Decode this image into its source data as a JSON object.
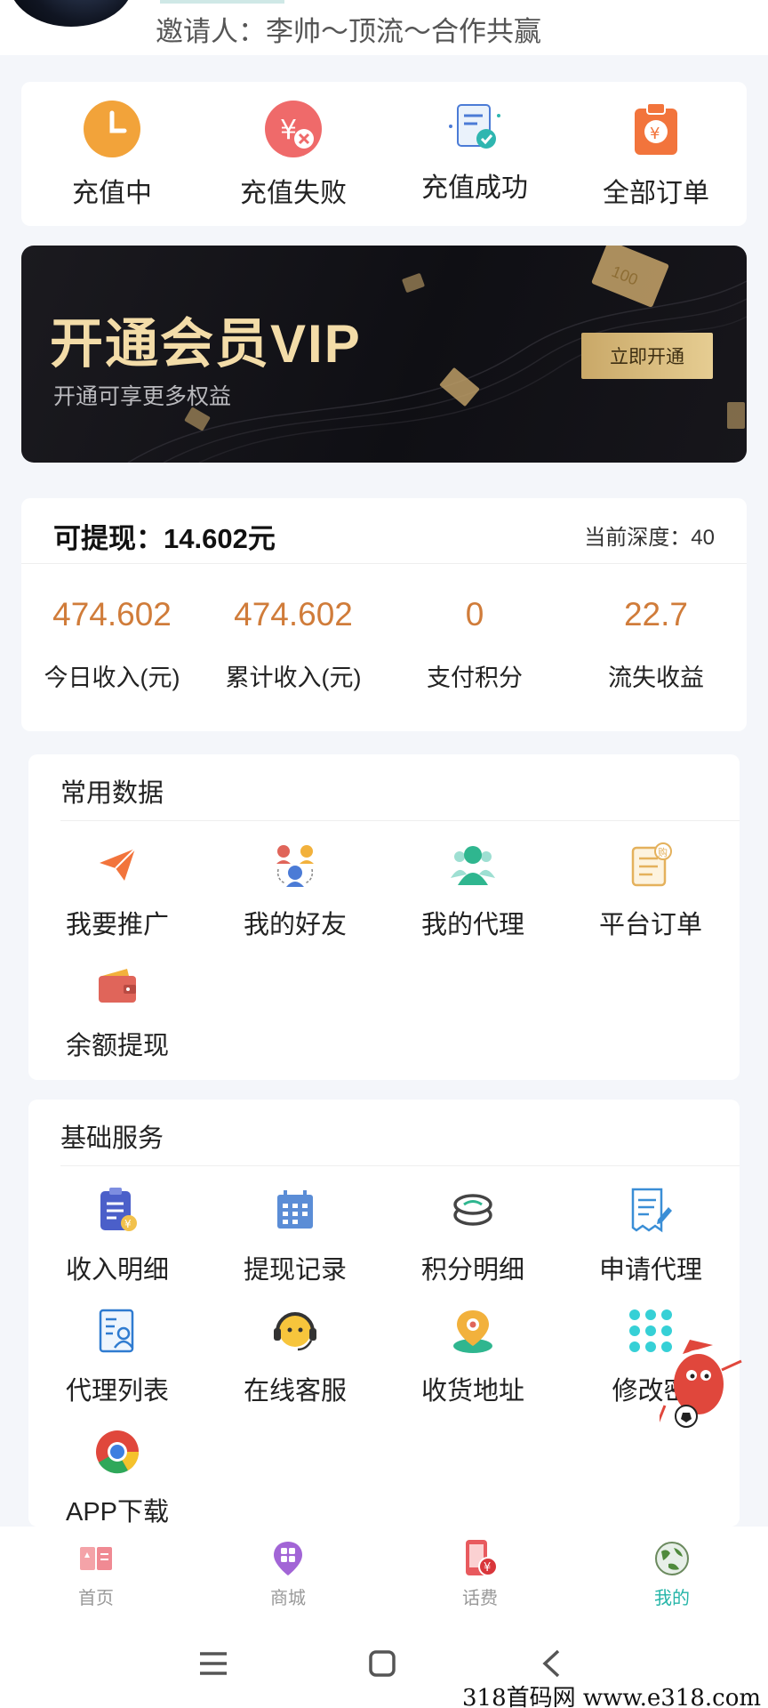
{
  "header": {
    "inviter_text": "邀请人：李帅～顶流～合作共赢"
  },
  "orders": [
    {
      "label": "充值中",
      "icon": "clock-icon"
    },
    {
      "label": "充值失败",
      "icon": "yuan-fail-icon"
    },
    {
      "label": "充值成功",
      "icon": "receipt-success-icon"
    },
    {
      "label": "全部订单",
      "icon": "order-bag-icon"
    }
  ],
  "vip_banner": {
    "title": "开通会员VIP",
    "subtitle": "开通可享更多权益",
    "button": "立即开通",
    "ticket_text": "100"
  },
  "balance": {
    "withdrawable": "可提现：14.602元",
    "depth": "当前深度：40",
    "stats": [
      {
        "value": "474.602",
        "label": "今日收入(元)"
      },
      {
        "value": "474.602",
        "label": "累计收入(元)"
      },
      {
        "value": "0",
        "label": "支付积分"
      },
      {
        "value": "22.7",
        "label": "流失收益"
      }
    ]
  },
  "common_section": {
    "title": "常用数据",
    "items": [
      {
        "label": "我要推广",
        "icon": "paper-plane-icon"
      },
      {
        "label": "我的好友",
        "icon": "friends-icon"
      },
      {
        "label": "我的代理",
        "icon": "agent-icon"
      },
      {
        "label": "平台订单",
        "icon": "platform-order-icon"
      },
      {
        "label": "余额提现",
        "icon": "wallet-icon"
      }
    ]
  },
  "basic_section": {
    "title": "基础服务",
    "items": [
      {
        "label": "收入明细",
        "icon": "income-detail-icon"
      },
      {
        "label": "提现记录",
        "icon": "calendar-icon"
      },
      {
        "label": "积分明细",
        "icon": "coins-icon"
      },
      {
        "label": "申请代理",
        "icon": "apply-form-icon"
      },
      {
        "label": "代理列表",
        "icon": "agent-list-icon"
      },
      {
        "label": "在线客服",
        "icon": "headset-icon"
      },
      {
        "label": "收货地址",
        "icon": "location-pin-icon"
      },
      {
        "label": "修改密",
        "icon": "keypad-icon"
      },
      {
        "label": "APP下载",
        "icon": "chrome-icon"
      }
    ]
  },
  "tabbar": [
    {
      "label": "首页",
      "icon": "home-card-icon",
      "active": false
    },
    {
      "label": "商城",
      "icon": "mall-pin-icon",
      "active": false
    },
    {
      "label": "话费",
      "icon": "phone-bill-icon",
      "active": false
    },
    {
      "label": "我的",
      "icon": "globe-icon",
      "active": true
    }
  ],
  "system_nav": [
    "menu-icon",
    "home-square-icon",
    "back-chevron-icon"
  ],
  "watermark": "318首码网  www.e318.com",
  "colors": {
    "accent_orange": "#d07c3a",
    "active_tab": "#25b5a8",
    "vip_gold": "#f3dca8"
  }
}
